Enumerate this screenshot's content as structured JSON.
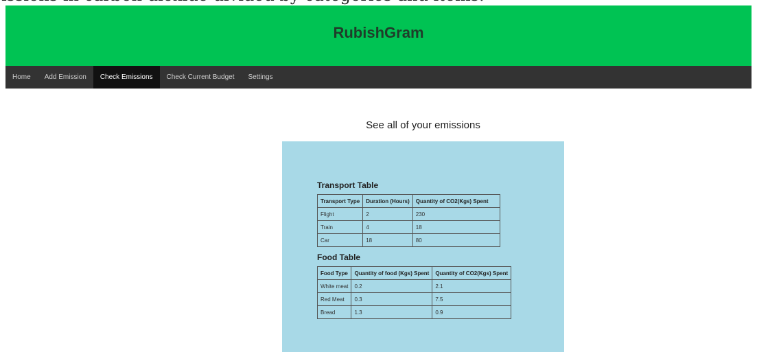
{
  "caption": "issions in carbon dioxide divided by categories and items.",
  "app": {
    "title": "RubishGram"
  },
  "nav": {
    "items": [
      {
        "label": "Home"
      },
      {
        "label": "Add Emission"
      },
      {
        "label": "Check Emissions",
        "active": true
      },
      {
        "label": "Check Current Budget"
      },
      {
        "label": "Settings"
      }
    ]
  },
  "main": {
    "heading": "See all of your emissions",
    "transport": {
      "title": "Transport Table",
      "headers": [
        "Transport Type",
        "Duration (Hours)",
        "Quantity of CO2(Kgs) Spent"
      ],
      "rows": [
        [
          "Flight",
          "2",
          "230"
        ],
        [
          "Train",
          "4",
          "18"
        ],
        [
          "Car",
          "18",
          "80"
        ]
      ]
    },
    "food": {
      "title": "Food Table",
      "headers": [
        "Food Type",
        "Quantity of food (Kgs) Spent",
        "Quantity of CO2(Kgs) Spent"
      ],
      "rows": [
        [
          "White meat",
          "0.2",
          "2.1"
        ],
        [
          "Red Meat",
          "0.3",
          "7.5"
        ],
        [
          "Bread",
          "1.3",
          "0.9"
        ]
      ]
    }
  },
  "colors": {
    "header_bg": "#00c353",
    "nav_bg": "#333333",
    "nav_active_bg": "#111111",
    "panel_bg": "#a8d9e7"
  }
}
